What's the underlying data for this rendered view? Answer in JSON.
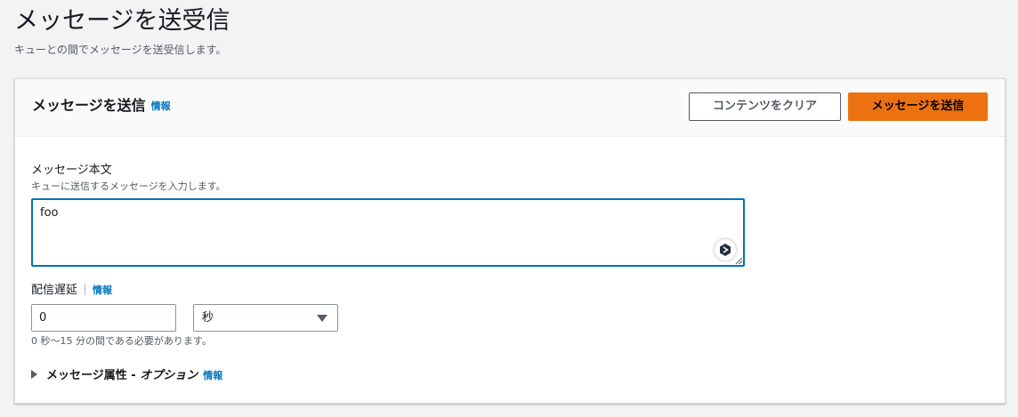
{
  "page": {
    "title": "メッセージを送受信",
    "description": "キューとの間でメッセージを送受信します。"
  },
  "panel": {
    "title": "メッセージを送信",
    "info": "情報",
    "clear_button": "コンテンツをクリア",
    "send_button": "メッセージを送信"
  },
  "body_field": {
    "label": "メッセージ本文",
    "description": "キューに送信するメッセージを入力します。",
    "value": "foo"
  },
  "delay_field": {
    "label": "配信遅延",
    "info": "情報",
    "value": "0",
    "unit": "秒",
    "hint": "0 秒〜15 分の間である必要があります。"
  },
  "attributes": {
    "label": "メッセージ属性 - ",
    "optional": "オプション",
    "info": "情報"
  },
  "colors": {
    "primary_button": "#ec7211",
    "link": "#0073bb",
    "focus_border": "#0073bb"
  },
  "icons": {
    "assist": "sparkle-assist-icon",
    "unit_dropdown": "caret-down-icon",
    "expander": "caret-right-icon"
  }
}
